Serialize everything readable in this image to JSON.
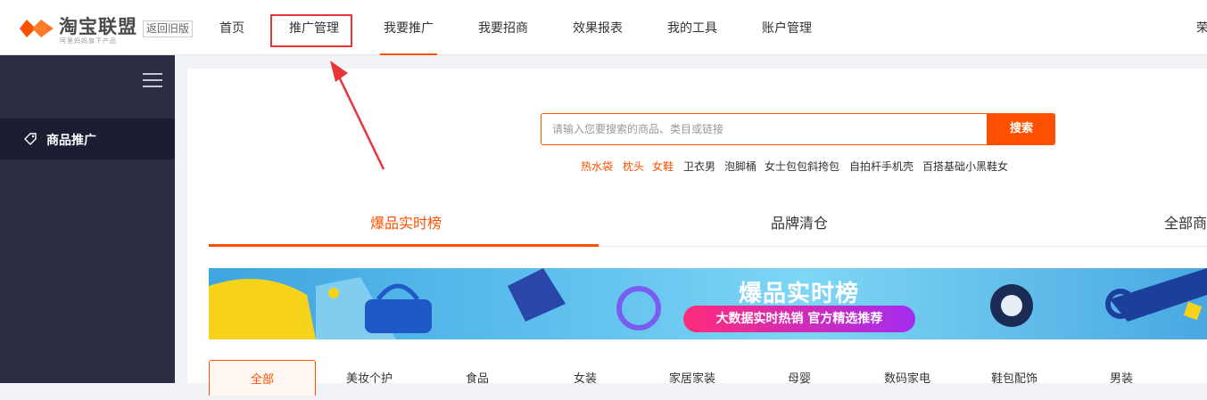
{
  "header": {
    "brand": "淘宝联盟",
    "brand_sub": "阿里妈妈旗下产品",
    "old_version": "返回旧版",
    "nav": [
      {
        "label": "首页"
      },
      {
        "label": "推广管理"
      },
      {
        "label": "我要推广"
      },
      {
        "label": "我要招商"
      },
      {
        "label": "效果报表"
      },
      {
        "label": "我的工具"
      },
      {
        "label": "账户管理"
      }
    ],
    "active_nav": "我要推广",
    "highlighted_nav": "推广管理",
    "right_text": "荣"
  },
  "sidebar": {
    "items": [
      {
        "label": "商品推广"
      }
    ]
  },
  "search": {
    "placeholder": "请输入您要搜索的商品、类目或链接",
    "button": "搜索",
    "hot": [
      {
        "label": "热水袋",
        "color": "#ff5000"
      },
      {
        "label": "枕头",
        "color": "#ff5000"
      },
      {
        "label": "女鞋",
        "color": "#ff5000"
      },
      {
        "label": "卫衣男",
        "color": "#333333"
      },
      {
        "label": "泡脚桶",
        "color": "#333333"
      },
      {
        "label": "女士包包斜挎包",
        "color": "#333333"
      },
      {
        "label": "自拍杆手机壳",
        "color": "#333333"
      },
      {
        "label": "百搭基础小黑鞋女",
        "color": "#333333"
      }
    ]
  },
  "tabs": [
    {
      "label": "爆品实时榜"
    },
    {
      "label": "品牌清仓"
    },
    {
      "label": "全部商"
    }
  ],
  "banner": {
    "title": "爆品实时榜",
    "subtitle": "大数据实时热销 官方精选推荐"
  },
  "categories": [
    {
      "label": "全部"
    },
    {
      "label": "美妆个护"
    },
    {
      "label": "食品"
    },
    {
      "label": "女装"
    },
    {
      "label": "家居家装"
    },
    {
      "label": "母婴"
    },
    {
      "label": "数码家电"
    },
    {
      "label": "鞋包配饰"
    },
    {
      "label": "男装"
    }
  ],
  "colors": {
    "accent": "#ff5000",
    "sidebar": "#2b2d45",
    "highlight": "#e8353a"
  }
}
